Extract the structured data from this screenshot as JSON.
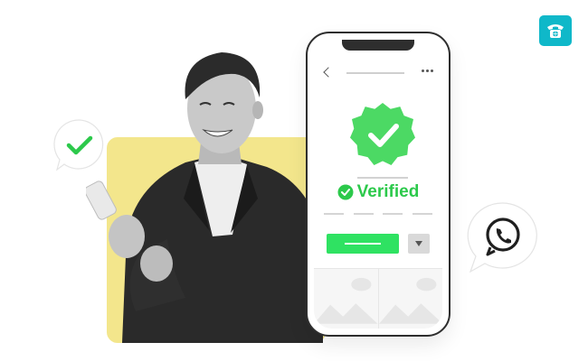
{
  "phone_screen": {
    "status_label": "Verified"
  },
  "colors": {
    "brand_accent": "#0fb8c9",
    "verified_green": "#2cc94b",
    "button_green": "#2fe262",
    "badge_green": "#4cd964",
    "card_yellow": "#f3e68c",
    "whatsapp_dark": "#1f1f1f"
  },
  "icons": {
    "corner_badge": "phone-globe-icon",
    "check_bubble": "check-icon",
    "whatsapp_bubble": "whatsapp-icon",
    "verified_badge": "verified-seal-icon",
    "back": "chevron-left-icon",
    "more": "more-dots-icon",
    "dropdown": "caret-down-icon",
    "tiles": "image-placeholder-icon"
  }
}
